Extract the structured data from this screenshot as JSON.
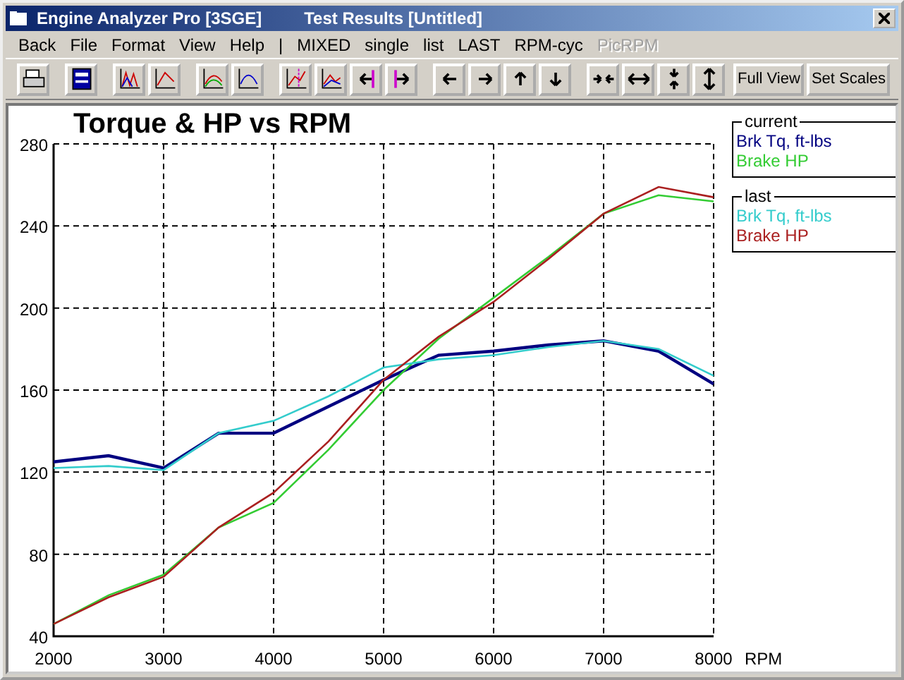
{
  "window": {
    "title": "Engine Analyzer Pro [3SGE]",
    "subtitle": "Test Results [Untitled]"
  },
  "menu": [
    {
      "label": "Back",
      "disabled": false
    },
    {
      "label": "File",
      "disabled": false
    },
    {
      "label": "Format",
      "disabled": false
    },
    {
      "label": "View",
      "disabled": false
    },
    {
      "label": "Help",
      "disabled": false
    },
    {
      "label": "|",
      "disabled": false
    },
    {
      "label": "MIXED",
      "disabled": false
    },
    {
      "label": "single",
      "disabled": false
    },
    {
      "label": "list",
      "disabled": false
    },
    {
      "label": "LAST",
      "disabled": false
    },
    {
      "label": "RPM-cyc",
      "disabled": false
    },
    {
      "label": "PicRPM",
      "disabled": true
    }
  ],
  "toolbar": {
    "text_buttons": [
      "Full View",
      "Set Scales"
    ]
  },
  "legend_groups": [
    "current",
    "last"
  ],
  "chart_data": {
    "type": "line",
    "grid": true,
    "title": "Torque & HP vs RPM",
    "xlabel": "RPM",
    "x": [
      2000,
      2500,
      3000,
      3500,
      4000,
      4500,
      5000,
      5500,
      6000,
      6500,
      7000,
      7500,
      8000
    ],
    "xlim": [
      2000,
      8000
    ],
    "ylim": [
      40,
      280
    ],
    "xticks": [
      2000,
      3000,
      4000,
      5000,
      6000,
      7000,
      8000
    ],
    "yticks": [
      40,
      80,
      120,
      160,
      200,
      240,
      280
    ],
    "series": [
      {
        "name": "Brk Tq, ft-lbs",
        "color": "#000080",
        "values": [
          125,
          128,
          122,
          139,
          139,
          152,
          165,
          177,
          179,
          182,
          184,
          179,
          163
        ]
      },
      {
        "name": "Brake HP",
        "color": "#33cc33",
        "values": [
          46,
          60,
          70,
          93,
          105,
          131,
          160,
          185,
          205,
          225,
          246,
          255,
          252
        ]
      },
      {
        "name": "Brk Tq, ft-lbs",
        "color": "#33cccc",
        "values": [
          122,
          123,
          121,
          139,
          145,
          157,
          171,
          175,
          177,
          181,
          184,
          180,
          167
        ]
      },
      {
        "name": "Brake HP",
        "color": "#aa2020",
        "values": [
          46,
          59,
          69,
          93,
          110,
          135,
          165,
          186,
          203,
          224,
          246,
          259,
          254
        ]
      }
    ]
  }
}
